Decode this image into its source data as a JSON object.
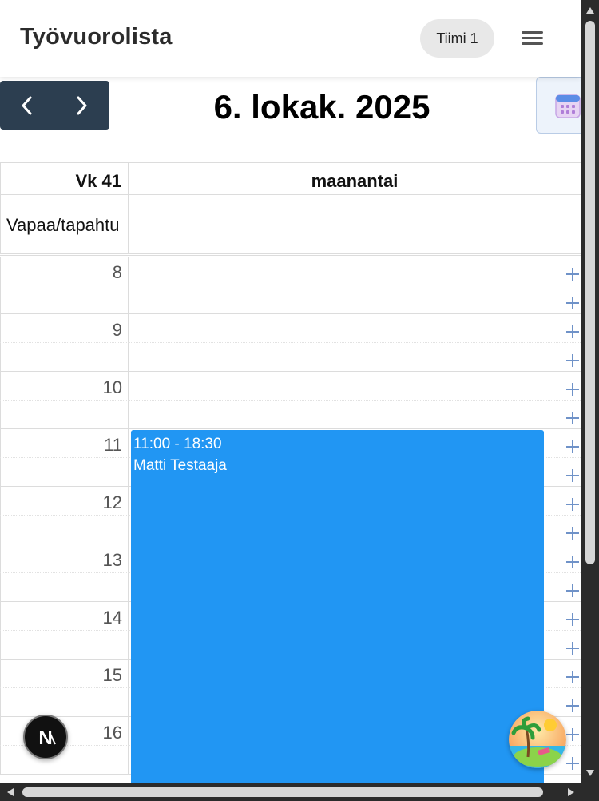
{
  "header": {
    "title": "Työvuorolista",
    "team": "Tiimi 1",
    "menu_icon": "hamburger-menu-icon"
  },
  "toolbar": {
    "title": "6. lokak. 2025",
    "prev_icon": "chevron-left-icon",
    "next_icon": "chevron-right-icon",
    "calendar_icon": "calendar-icon"
  },
  "grid": {
    "week": "Vk 41",
    "day": "maanantai",
    "allday_label": "Vapaa/tapahtu",
    "hours": [
      "8",
      "9",
      "10",
      "11",
      "12",
      "13",
      "14",
      "15",
      "16"
    ]
  },
  "event": {
    "time": "11:00 - 18:30",
    "name": "Matti Testaaja",
    "color": "#2196f3"
  },
  "floating": {
    "badge_letter": "N",
    "vacation_icon": "palm-beach-icon"
  },
  "colors": {
    "nav": "#2c3e50",
    "plus": "#6f92c8"
  }
}
